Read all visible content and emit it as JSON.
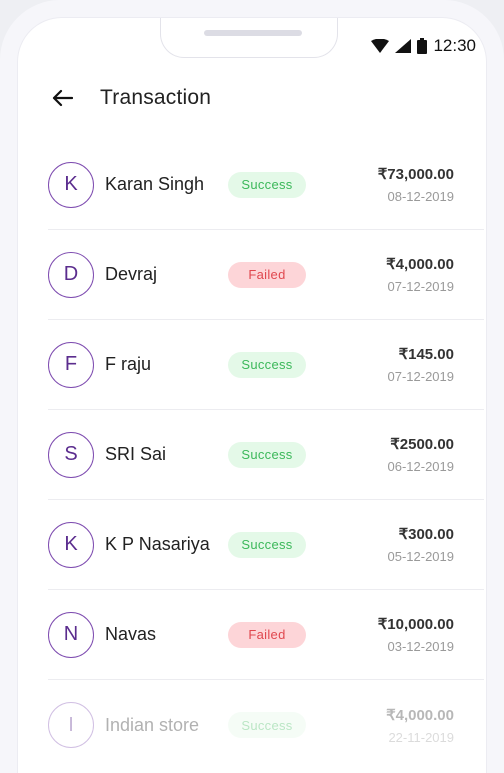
{
  "status_bar": {
    "time": "12:30"
  },
  "header": {
    "title": "Transaction"
  },
  "transactions": [
    {
      "initial": "K",
      "name": "Karan Singh",
      "status": "Success",
      "status_type": "success",
      "amount": "₹73,000.00",
      "date": "08-12-2019"
    },
    {
      "initial": "D",
      "name": "Devraj",
      "status": "Failed",
      "status_type": "failed",
      "amount": "₹4,000.00",
      "date": "07-12-2019"
    },
    {
      "initial": "F",
      "name": "F raju",
      "status": "Success",
      "status_type": "success",
      "amount": "₹145.00",
      "date": "07-12-2019"
    },
    {
      "initial": "S",
      "name": "SRI Sai",
      "status": "Success",
      "status_type": "success",
      "amount": "₹2500.00",
      "date": "06-12-2019"
    },
    {
      "initial": "K",
      "name": "K P Nasariya",
      "status": "Success",
      "status_type": "success",
      "amount": "₹300.00",
      "date": "05-12-2019"
    },
    {
      "initial": "N",
      "name": "Navas",
      "status": "Failed",
      "status_type": "failed",
      "amount": "₹10,000.00",
      "date": "03-12-2019"
    },
    {
      "initial": "I",
      "name": "Indian store",
      "status": "Success",
      "status_type": "success",
      "amount": "₹4,000.00",
      "date": "22-11-2019"
    }
  ],
  "colors": {
    "accent": "#7e4cb0",
    "success_bg": "#e4f9e8",
    "success_fg": "#3cb85a",
    "failed_bg": "#fdd5d8",
    "failed_fg": "#e0484f"
  }
}
